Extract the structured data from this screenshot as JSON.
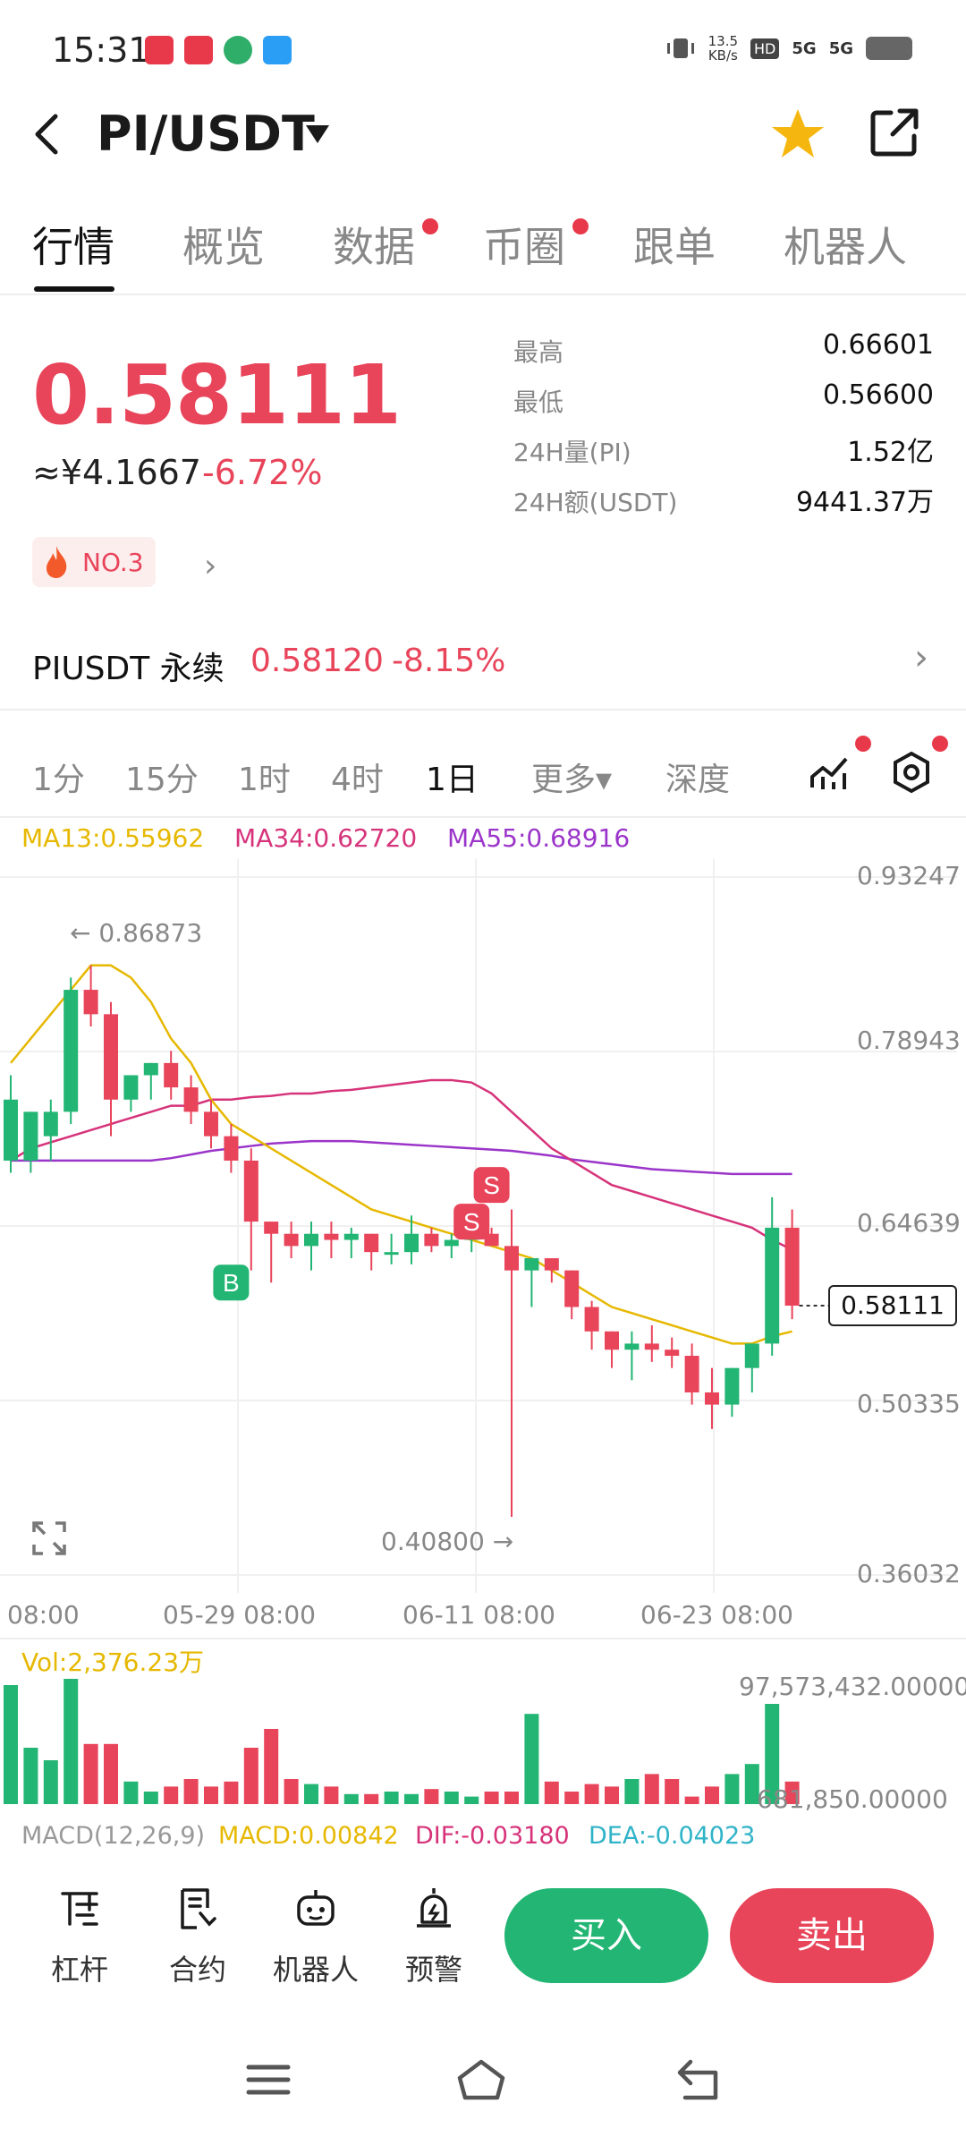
{
  "status_bar": {
    "time": "15:31",
    "net_speed_value": "13.5",
    "net_speed_unit": "KB/s",
    "network_1": "5G",
    "network_2": "5G"
  },
  "header": {
    "pair": "PI/USDT"
  },
  "tabs": [
    {
      "label": "行情",
      "active": true,
      "dot": false
    },
    {
      "label": "概览",
      "active": false,
      "dot": false
    },
    {
      "label": "数据",
      "active": false,
      "dot": true
    },
    {
      "label": "币圈",
      "active": false,
      "dot": true
    },
    {
      "label": "跟单",
      "active": false,
      "dot": false
    },
    {
      "label": "机器人",
      "active": false,
      "dot": false
    }
  ],
  "price": {
    "last": "0.58111",
    "cny": "≈¥4.1667",
    "change_pct": "-6.72%",
    "rank": "NO.3"
  },
  "stats": {
    "high_label": "最高",
    "high": "0.66601",
    "low_label": "最低",
    "low": "0.56600",
    "vol_label": "24H量(PI)",
    "vol": "1.52亿",
    "amount_label": "24H额(USDT)",
    "amount": "9441.37万"
  },
  "perpetual": {
    "name": "PIUSDT 永续",
    "price": "0.58120",
    "change_pct": "-8.15%"
  },
  "intervals": [
    {
      "label": "1分",
      "active": false
    },
    {
      "label": "15分",
      "active": false
    },
    {
      "label": "1时",
      "active": false
    },
    {
      "label": "4时",
      "active": false
    },
    {
      "label": "1日",
      "active": true
    },
    {
      "label": "更多▾",
      "active": false
    },
    {
      "label": "深度",
      "active": false
    }
  ],
  "ma_legend": {
    "ma13": "MA13:0.55962",
    "ma34": "MA34:0.62720",
    "ma55": "MA55:0.68916"
  },
  "colors": {
    "up": "#22b573",
    "down": "#e8445a",
    "ma13": "#e6b800",
    "ma34": "#d6337a",
    "ma55": "#9b35c9"
  },
  "chart_data": {
    "type": "candlestick",
    "y_ticks": [
      "0.93247",
      "0.78943",
      "0.64639",
      "0.50335",
      "0.36032"
    ],
    "x_ticks": [
      "08:00",
      "05-29 08:00",
      "06-11 08:00",
      "06-23 08:00"
    ],
    "ylim": [
      0.36032,
      0.93247
    ],
    "current_price": "0.58111",
    "max_label": "← 0.86873",
    "min_label": "0.40800 →",
    "markers": [
      {
        "label": "B",
        "index": 11,
        "price": 0.6,
        "color": "#22b573"
      },
      {
        "label": "S",
        "index": 24,
        "price": 0.68,
        "color": "#e8445a"
      },
      {
        "label": "S",
        "index": 23,
        "price": 0.65,
        "color": "#e8445a"
      }
    ],
    "candles": [
      {
        "o": 0.7,
        "h": 0.77,
        "l": 0.69,
        "c": 0.75
      },
      {
        "o": 0.7,
        "h": 0.74,
        "l": 0.69,
        "c": 0.74
      },
      {
        "o": 0.72,
        "h": 0.75,
        "l": 0.7,
        "c": 0.74
      },
      {
        "o": 0.74,
        "h": 0.85,
        "l": 0.73,
        "c": 0.84
      },
      {
        "o": 0.84,
        "h": 0.86,
        "l": 0.81,
        "c": 0.82
      },
      {
        "o": 0.82,
        "h": 0.83,
        "l": 0.72,
        "c": 0.75
      },
      {
        "o": 0.75,
        "h": 0.77,
        "l": 0.74,
        "c": 0.77
      },
      {
        "o": 0.77,
        "h": 0.78,
        "l": 0.75,
        "c": 0.78
      },
      {
        "o": 0.78,
        "h": 0.79,
        "l": 0.75,
        "c": 0.76
      },
      {
        "o": 0.76,
        "h": 0.77,
        "l": 0.73,
        "c": 0.74
      },
      {
        "o": 0.74,
        "h": 0.75,
        "l": 0.71,
        "c": 0.72
      },
      {
        "o": 0.72,
        "h": 0.73,
        "l": 0.69,
        "c": 0.7
      },
      {
        "o": 0.7,
        "h": 0.71,
        "l": 0.61,
        "c": 0.65
      },
      {
        "o": 0.65,
        "h": 0.65,
        "l": 0.6,
        "c": 0.64
      },
      {
        "o": 0.64,
        "h": 0.65,
        "l": 0.62,
        "c": 0.63
      },
      {
        "o": 0.63,
        "h": 0.65,
        "l": 0.61,
        "c": 0.64
      },
      {
        "o": 0.64,
        "h": 0.65,
        "l": 0.62,
        "c": 0.635
      },
      {
        "o": 0.635,
        "h": 0.645,
        "l": 0.62,
        "c": 0.64
      },
      {
        "o": 0.64,
        "h": 0.64,
        "l": 0.61,
        "c": 0.625
      },
      {
        "o": 0.625,
        "h": 0.64,
        "l": 0.615,
        "c": 0.625
      },
      {
        "o": 0.625,
        "h": 0.655,
        "l": 0.615,
        "c": 0.64
      },
      {
        "o": 0.64,
        "h": 0.645,
        "l": 0.625,
        "c": 0.63
      },
      {
        "o": 0.63,
        "h": 0.64,
        "l": 0.62,
        "c": 0.635
      },
      {
        "o": 0.635,
        "h": 0.645,
        "l": 0.625,
        "c": 0.64
      },
      {
        "o": 0.64,
        "h": 0.645,
        "l": 0.63,
        "c": 0.63
      },
      {
        "o": 0.63,
        "h": 0.66,
        "l": 0.408,
        "c": 0.61
      },
      {
        "o": 0.61,
        "h": 0.62,
        "l": 0.58,
        "c": 0.62
      },
      {
        "o": 0.62,
        "h": 0.62,
        "l": 0.6,
        "c": 0.61
      },
      {
        "o": 0.61,
        "h": 0.61,
        "l": 0.57,
        "c": 0.58
      },
      {
        "o": 0.58,
        "h": 0.585,
        "l": 0.545,
        "c": 0.56
      },
      {
        "o": 0.56,
        "h": 0.56,
        "l": 0.53,
        "c": 0.545
      },
      {
        "o": 0.545,
        "h": 0.56,
        "l": 0.52,
        "c": 0.55
      },
      {
        "o": 0.55,
        "h": 0.565,
        "l": 0.535,
        "c": 0.545
      },
      {
        "o": 0.545,
        "h": 0.555,
        "l": 0.53,
        "c": 0.54
      },
      {
        "o": 0.54,
        "h": 0.55,
        "l": 0.5,
        "c": 0.51
      },
      {
        "o": 0.51,
        "h": 0.53,
        "l": 0.48,
        "c": 0.5
      },
      {
        "o": 0.5,
        "h": 0.53,
        "l": 0.49,
        "c": 0.53
      },
      {
        "o": 0.53,
        "h": 0.55,
        "l": 0.51,
        "c": 0.55
      },
      {
        "o": 0.55,
        "h": 0.67,
        "l": 0.54,
        "c": 0.645
      },
      {
        "o": 0.645,
        "h": 0.66,
        "l": 0.57,
        "c": 0.58111
      }
    ],
    "ma13": [
      0.78,
      0.8,
      0.82,
      0.84,
      0.86,
      0.86,
      0.85,
      0.83,
      0.8,
      0.78,
      0.75,
      0.73,
      0.72,
      0.71,
      0.7,
      0.69,
      0.68,
      0.67,
      0.66,
      0.655,
      0.65,
      0.645,
      0.64,
      0.635,
      0.63,
      0.625,
      0.62,
      0.61,
      0.6,
      0.59,
      0.58,
      0.575,
      0.57,
      0.565,
      0.56,
      0.555,
      0.55,
      0.55,
      0.556,
      0.56
    ],
    "ma34": [
      0.7,
      0.71,
      0.715,
      0.72,
      0.725,
      0.73,
      0.735,
      0.74,
      0.745,
      0.745,
      0.75,
      0.75,
      0.752,
      0.753,
      0.755,
      0.755,
      0.757,
      0.758,
      0.76,
      0.762,
      0.764,
      0.766,
      0.766,
      0.764,
      0.755,
      0.74,
      0.725,
      0.71,
      0.7,
      0.69,
      0.68,
      0.675,
      0.67,
      0.665,
      0.66,
      0.655,
      0.65,
      0.645,
      0.635,
      0.627
    ],
    "ma55": [
      0.7,
      0.7,
      0.7,
      0.7,
      0.7,
      0.7,
      0.7,
      0.7,
      0.702,
      0.705,
      0.708,
      0.71,
      0.712,
      0.714,
      0.715,
      0.716,
      0.716,
      0.716,
      0.715,
      0.714,
      0.713,
      0.712,
      0.711,
      0.71,
      0.709,
      0.708,
      0.706,
      0.704,
      0.701,
      0.699,
      0.697,
      0.695,
      0.693,
      0.692,
      0.691,
      0.69,
      0.689,
      0.689,
      0.689,
      0.689
    ],
    "volume": {
      "label": "Vol:2,376.23万",
      "y_ticks": [
        "97,573,432.00000",
        "681,850.00000"
      ],
      "values": [
        95,
        45,
        35,
        100,
        48,
        48,
        18,
        10,
        14,
        20,
        14,
        18,
        45,
        60,
        20,
        16,
        14,
        8,
        8,
        10,
        8,
        12,
        10,
        6,
        10,
        10,
        72,
        18,
        10,
        16,
        14,
        20,
        24,
        20,
        6,
        14,
        24,
        32,
        80,
        18
      ]
    },
    "macd": {
      "title": "MACD(12,26,9)",
      "macd": "MACD:0.00842",
      "dif": "DIF:-0.03180",
      "dea": "DEA:-0.04023"
    }
  },
  "actions": {
    "leverage": "杠杆",
    "contract": "合约",
    "robot": "机器人",
    "alert": "预警",
    "buy": "买入",
    "sell": "卖出"
  }
}
